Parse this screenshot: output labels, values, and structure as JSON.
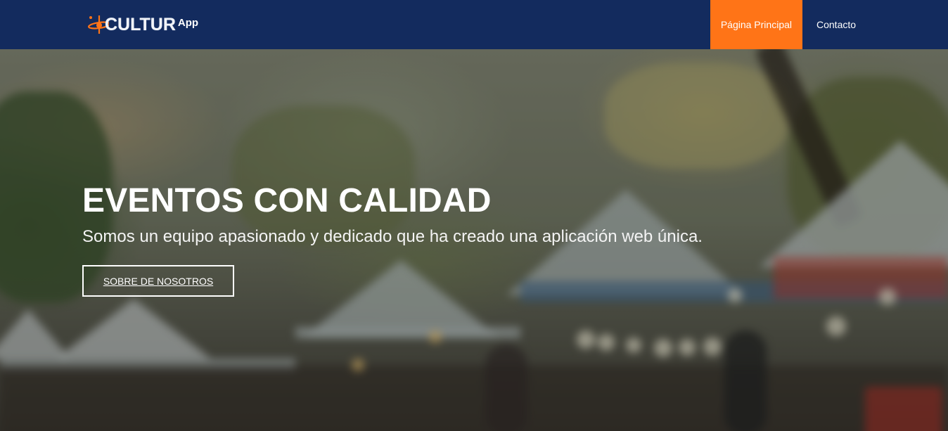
{
  "navbar": {
    "brand": {
      "word": "CULTUR",
      "suffix": "App",
      "icon": "logo-orbit-icon"
    },
    "links": [
      {
        "label": "Página Principal",
        "active": true
      },
      {
        "label": "Contacto",
        "active": false
      }
    ],
    "colors": {
      "background": "#132b5e",
      "active": "#ff7417"
    }
  },
  "hero": {
    "title": "EVENTOS CON CALIDAD",
    "subtitle": "Somos un equipo apasionado y dedicado que ha creado una aplicación web única.",
    "button_label": "SOBRE DE NOSOTROS",
    "background_image": "blurred outdoor market with white tents and trees"
  }
}
